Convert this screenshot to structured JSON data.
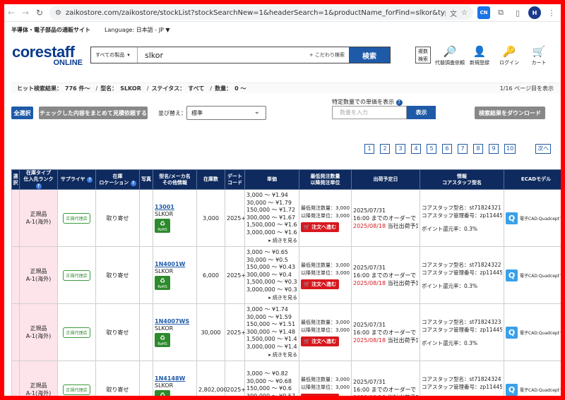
{
  "browser": {
    "url": "zaikostore.com/zaikostore/stockList?stockSearchNew=1&headerSearch=1&productName_forFind=slkor&typeStock_forFind=all&viewCou...",
    "profile_initial": "H",
    "ext_badge": "CN"
  },
  "site": {
    "tagline": "半導体・電子部品の通販サイト",
    "language": "Language: 日本語 - JP ▼",
    "logo_main": "corestaff",
    "logo_sub": "ONLINE"
  },
  "search": {
    "category": "すべての製品",
    "value": "slkor",
    "advanced": "+ こだわり検索",
    "button": "検索",
    "multi": "複数検索"
  },
  "header_icons": [
    {
      "name": "proxy-search",
      "glyph": "🔎",
      "label": "代替調査依頼"
    },
    {
      "name": "register",
      "glyph": "👤",
      "label": "新規登録"
    },
    {
      "name": "login",
      "glyph": "🔑",
      "label": "ログイン"
    },
    {
      "name": "cart",
      "glyph": "🛒",
      "label": "カート"
    },
    {
      "name": "quote",
      "glyph": "📄",
      "label": "見積"
    }
  ],
  "summary": {
    "hits_label": "ヒット検索結果：",
    "hits_value": "776 件〜",
    "model_label": "型名：",
    "model_value": "SLKOR",
    "status_label": "ステイタス：",
    "status_value": "すべて",
    "qty_label": "数量：",
    "qty_value": "0 〜",
    "page": "1/16 ページ目を表示"
  },
  "controls": {
    "select_all": "全選択",
    "bulk_quote": "チェックした内容をまとめて見積依頼する",
    "sort_label": "並び替え：",
    "sort_value": "標準",
    "qty_price_label": "特定数量での単価を表示",
    "qty_placeholder": "数量を入力",
    "qty_button": "表示",
    "download": "検索結果をダウンロード"
  },
  "pagination": [
    "1",
    "2",
    "3",
    "4",
    "5",
    "6",
    "7",
    "8",
    "9",
    "10"
  ],
  "pagination_next": "次へ",
  "columns": {
    "sel": "選択",
    "rank": "在庫タイプ\n仕入先ランク",
    "supplier": "サプライヤ",
    "location": "在庫\nロケーション",
    "photo": "写真",
    "model": "型名/メーカ名\nその他情報",
    "stock": "在庫数",
    "datecode": "デート\nコード",
    "price": "単価",
    "moq": "最低発注数量\n以降発注単位",
    "ship": "出荷予定日",
    "info": "情報\nコアスタッフ型名",
    "ecad": "ECADモデル"
  },
  "rows": [
    {
      "rank1": "正規品",
      "rank2": "A-1(海外)",
      "agent": "正規代理店",
      "location": "取り寄せ",
      "part": "13001",
      "maker": "SLKOR",
      "rohs": "RoHS",
      "stock": "3,000",
      "datecode": "2025+",
      "prices": [
        "3,000 〜 ¥1.94",
        "30,000 〜 ¥1.79",
        "150,000 〜 ¥1.72",
        "300,000 〜 ¥1.67",
        "1,500,000 〜 ¥1.65",
        "3,000,000 〜 ¥1.64"
      ],
      "more": "▸ 続きを見る",
      "moq1": "最低発注数量：3,000",
      "moq2": "以降発注単位：3,000",
      "cart": "注文へ進む",
      "ship1": "2025/07/31",
      "ship2": "16:00 までのオーダーで",
      "ship3": "2025/08/18",
      "ship4": "当社出荷予定",
      "cmodel": "コアスタッフ型名：st71824321",
      "mgmt": "コアスタッフ管理番号：zp11445",
      "points": "ポイント還元率：0.3%",
      "ecad": "電子CAD:Quadceptで"
    },
    {
      "rank1": "正規品",
      "rank2": "A-1(海外)",
      "agent": "正規代理店",
      "location": "取り寄せ",
      "part": "1N4001W",
      "maker": "SLKOR",
      "rohs": "RoHS",
      "stock": "6,000",
      "datecode": "2025+",
      "prices": [
        "3,000 〜 ¥0.65",
        "30,000 〜 ¥0.5",
        "150,000 〜 ¥0.43",
        "300,000 〜 ¥0.4",
        "1,500,000 〜 ¥0.38",
        "3,000,000 〜 ¥0.37"
      ],
      "more": "▸ 続きを見る",
      "moq1": "最低発注数量：3,000",
      "moq2": "以降発注単位：3,000",
      "cart": "注文へ進む",
      "ship1": "2025/07/31",
      "ship2": "16:00 までのオーダーで",
      "ship3": "2025/08/18",
      "ship4": "当社出荷予定",
      "cmodel": "コアスタッフ型名：st71824322",
      "mgmt": "コアスタッフ管理番号：zp11445",
      "points": "ポイント還元率：0.3%",
      "ecad": "電子CAD:Quadceptで"
    },
    {
      "rank1": "正規品",
      "rank2": "A-1(海外)",
      "agent": "正規代理店",
      "location": "取り寄せ",
      "part": "1N4007WS",
      "maker": "SLKOR",
      "rohs": "RoHS",
      "stock": "30,000",
      "datecode": "2025+",
      "prices": [
        "3,000 〜 ¥1.74",
        "30,000 〜 ¥1.59",
        "150,000 〜 ¥1.51",
        "300,000 〜 ¥1.48",
        "1,500,000 〜 ¥1.47",
        "3,000,000 〜 ¥1.46"
      ],
      "more": "▸ 続きを見る",
      "moq1": "最低発注数量：3,000",
      "moq2": "以降発注単位：3,000",
      "cart": "注文へ進む",
      "ship1": "2025/07/31",
      "ship2": "16:00 までのオーダーで",
      "ship3": "2025/08/18",
      "ship4": "当社出荷予定",
      "cmodel": "コアスタッフ型名：st71824323",
      "mgmt": "コアスタッフ管理番号：zp11445",
      "points": "ポイント還元率：0.3%",
      "ecad": "電子CAD:Quadceptで"
    },
    {
      "rank1": "正規品",
      "rank2": "A-1(海外)",
      "agent": "正規代理店",
      "location": "取り寄せ",
      "part": "1N4148W",
      "maker": "SLKOR",
      "rohs": "RoHS",
      "stock": "2,802,000",
      "datecode": "2025+",
      "prices": [
        "3,000 〜 ¥0.82",
        "30,000 〜 ¥0.68",
        "150,000 〜 ¥0.6",
        "300,000 〜 ¥0.57",
        "1,500,000 〜 ¥0.56"
      ],
      "more": "",
      "moq1": "最低発注数量：3,000",
      "moq2": "以降発注単位：3,000",
      "cart": "注文へ進む",
      "ship1": "2025/07/31",
      "ship2": "16:00 までのオーダーで",
      "ship3": "2025/08/18",
      "ship4": "当社出荷予定",
      "cmodel": "コアスタッフ型名：st71824324",
      "mgmt": "コアスタッフ管理番号：zp11445",
      "points": "ポイント還元率：0.3%",
      "ecad": "電子CAD:Quadceptで"
    }
  ]
}
